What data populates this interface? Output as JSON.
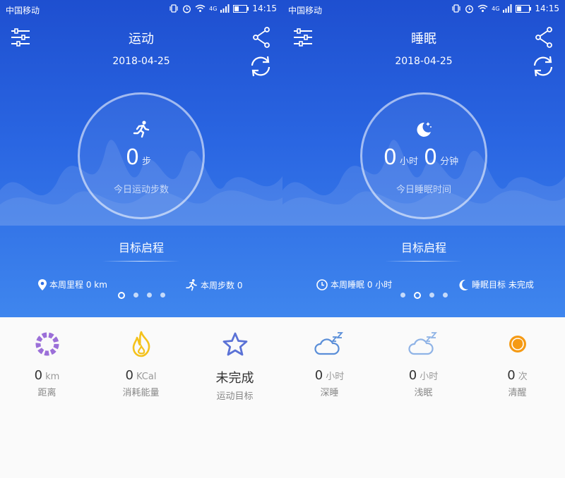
{
  "status_bar": {
    "carrier": "中国移动",
    "network": "4G",
    "time": "14:15"
  },
  "screens": [
    {
      "title": "运动",
      "date": "2018-04-25",
      "ring": {
        "value": "0",
        "unit": "步",
        "label": "今日运动步数",
        "icon": "running-person-icon"
      },
      "goal_label": "目标启程",
      "week_left": "本周里程 0 km",
      "week_right": "本周步数 0",
      "page_index": 0,
      "page_count": 4,
      "stats": [
        {
          "icon": "distance-ring-icon",
          "value": "0",
          "unit": "km",
          "label": "距离"
        },
        {
          "icon": "flame-icon",
          "value": "0",
          "unit": "KCal",
          "label": "消耗能量"
        },
        {
          "icon": "star-icon",
          "value": "未完成",
          "unit": "",
          "label": "运动目标"
        }
      ]
    },
    {
      "title": "睡眠",
      "date": "2018-04-25",
      "ring": {
        "value_hours": "0",
        "unit_hours": "小时",
        "value_minutes": "0",
        "unit_minutes": "分钟",
        "label": "今日睡眠时间",
        "icon": "moon-stars-icon"
      },
      "goal_label": "目标启程",
      "week_left": "本周睡眠 0 小时",
      "week_right": "睡眠目标 未完成",
      "page_index": 1,
      "page_count": 4,
      "stats": [
        {
          "icon": "deep-sleep-cloud-icon",
          "value": "0",
          "unit": "小时",
          "label": "深睡"
        },
        {
          "icon": "light-sleep-cloud-icon",
          "value": "0",
          "unit": "小时",
          "label": "浅眠"
        },
        {
          "icon": "awake-circle-icon",
          "value": "0",
          "unit": "次",
          "label": "清醒"
        }
      ]
    }
  ],
  "colors": {
    "hero_top": "#1e4fd0",
    "hero_bottom": "#3f86ee",
    "distance": "#9b6fd8",
    "flame": "#f4c21c",
    "star": "#5b72d6",
    "sleep_cloud": "#5a8ed8",
    "awake": "#f59a14"
  }
}
